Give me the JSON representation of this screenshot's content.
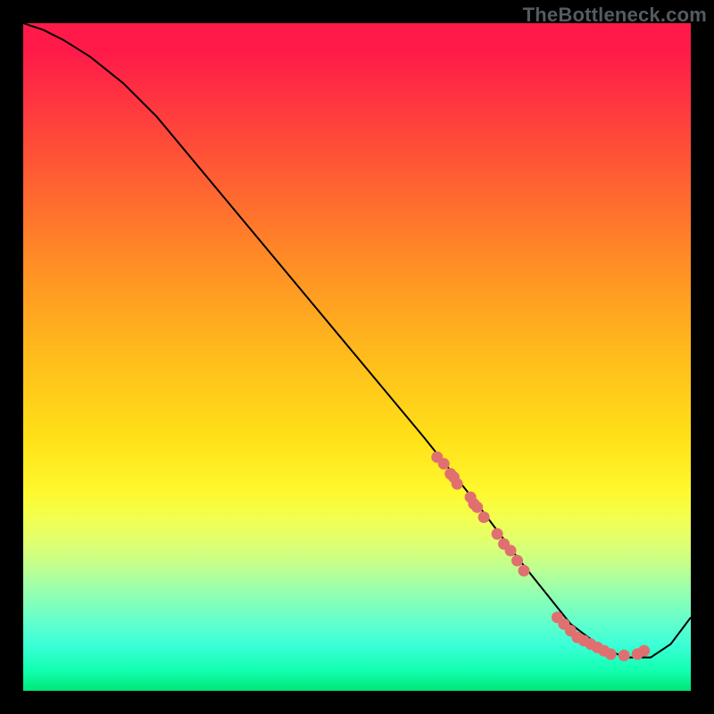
{
  "watermark": "TheBottleneck.com",
  "colors": {
    "gradient_top": "#ff1a49",
    "gradient_mid": "#ffe018",
    "gradient_bottom": "#00e676",
    "curve": "#000000",
    "points": "#e07070",
    "background": "#000000"
  },
  "chart_data": {
    "type": "line",
    "title": "",
    "xlabel": "",
    "ylabel": "",
    "xlim": [
      0,
      100
    ],
    "ylim": [
      0,
      100
    ],
    "grid": false,
    "legend": false,
    "series": [
      {
        "name": "curve",
        "x": [
          0,
          3,
          6,
          10,
          15,
          20,
          30,
          40,
          50,
          60,
          68,
          74,
          78,
          82,
          86,
          90,
          94,
          97,
          100
        ],
        "y": [
          100,
          99,
          97.5,
          95,
          91,
          86,
          74,
          62,
          50,
          38,
          28,
          20,
          15,
          10,
          7,
          5,
          5,
          7,
          11
        ]
      }
    ],
    "scatter": {
      "name": "markers",
      "points": [
        {
          "x": 62,
          "y": 35
        },
        {
          "x": 63,
          "y": 34
        },
        {
          "x": 64,
          "y": 32.5
        },
        {
          "x": 64.5,
          "y": 32
        },
        {
          "x": 65,
          "y": 31
        },
        {
          "x": 67,
          "y": 29
        },
        {
          "x": 67.5,
          "y": 28
        },
        {
          "x": 68,
          "y": 27.5
        },
        {
          "x": 69,
          "y": 26
        },
        {
          "x": 71,
          "y": 23.5
        },
        {
          "x": 72,
          "y": 22
        },
        {
          "x": 73,
          "y": 21
        },
        {
          "x": 74,
          "y": 19.5
        },
        {
          "x": 75,
          "y": 18
        },
        {
          "x": 80,
          "y": 11
        },
        {
          "x": 81,
          "y": 10
        },
        {
          "x": 82,
          "y": 9
        },
        {
          "x": 83,
          "y": 8
        },
        {
          "x": 84,
          "y": 7.5
        },
        {
          "x": 85,
          "y": 7
        },
        {
          "x": 86,
          "y": 6.5
        },
        {
          "x": 87,
          "y": 6
        },
        {
          "x": 88,
          "y": 5.5
        },
        {
          "x": 90,
          "y": 5.3
        },
        {
          "x": 92,
          "y": 5.5
        },
        {
          "x": 93,
          "y": 6
        }
      ]
    }
  }
}
